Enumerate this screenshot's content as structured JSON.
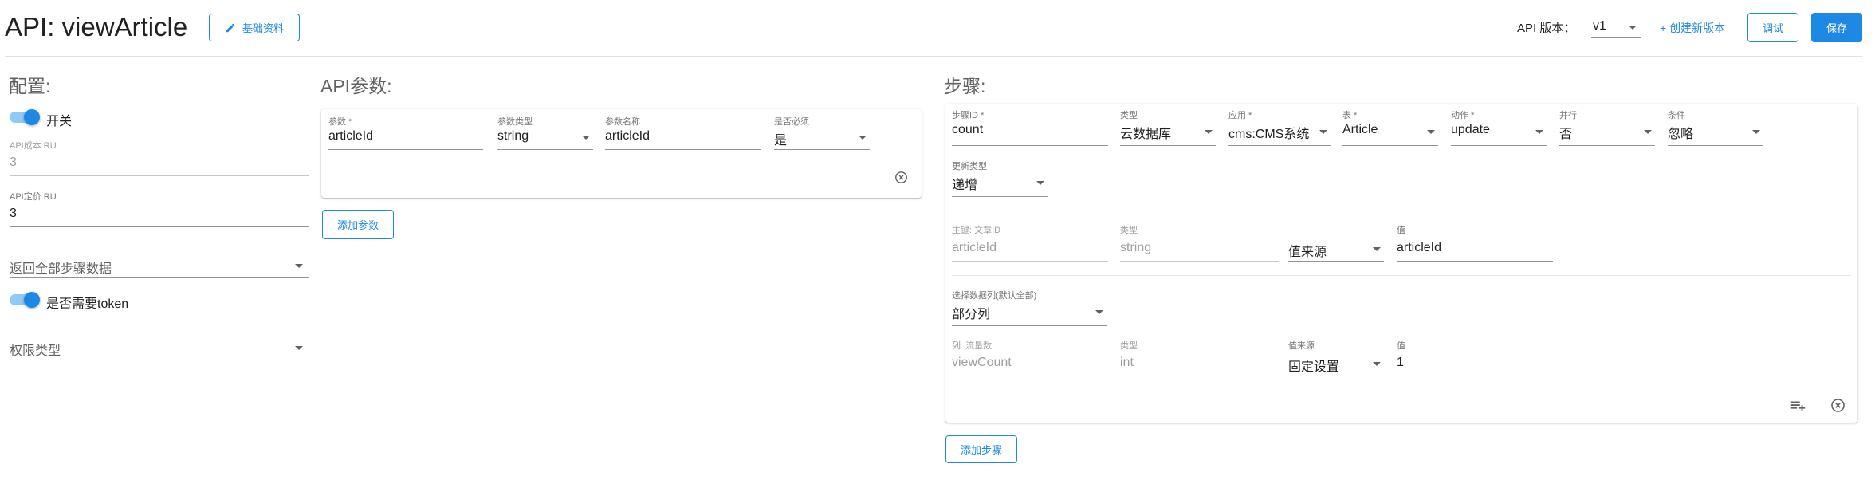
{
  "header": {
    "title": "API: viewArticle",
    "basic_info_label": "基础资料",
    "version_label": "API 版本：",
    "version_value": "v1",
    "create_version_label": "+ 创建新版本",
    "debug_label": "调试",
    "save_label": "保存"
  },
  "config": {
    "title": "配置:",
    "switch_label": "开关",
    "cost_label": "API成本:RU",
    "cost_value": "3",
    "price_label": "API定价:RU",
    "price_value": "3",
    "return_steps_placeholder": "返回全部步骤数据",
    "token_label": "是否需要token",
    "permission_placeholder": "权限类型"
  },
  "params": {
    "title": "API参数:",
    "headers": {
      "param": "参数 *",
      "type": "参数类型",
      "name": "参数名称",
      "required": "是否必须"
    },
    "row": {
      "param": "articleId",
      "type": "string",
      "name": "articleId",
      "required": "是"
    },
    "add_label": "添加参数"
  },
  "steps": {
    "title": "步骤:",
    "headers": {
      "step_id": "步骤ID *",
      "type": "类型",
      "app": "应用 *",
      "table": "表 *",
      "action": "动作 *",
      "parallel": "并行",
      "condition": "条件"
    },
    "values": {
      "step_id": "count",
      "type": "云数据库",
      "app": "cms:CMS系统",
      "table": "Article",
      "action": "update",
      "parallel": "否",
      "condition": "忽略"
    },
    "update_type_label": "更新类型",
    "update_type_value": "递增",
    "key_row": {
      "key_label": "主键: 文章ID",
      "key_value": "articleId",
      "type_label": "类型",
      "type_value": "string",
      "source_value": "值来源",
      "value_label": "值",
      "value": "articleId"
    },
    "columns_label": "选择数据列(默认全部)",
    "columns_value": "部分列",
    "col_row": {
      "col_label": "列: 流量数",
      "col_value": "viewCount",
      "type_label": "类型",
      "type_value": "int",
      "source_label": "值来源",
      "source_value": "固定设置",
      "value_label": "值",
      "value": "1"
    },
    "add_label": "添加步骤"
  },
  "colors": {
    "accent": "#1e88e5",
    "toggle_track": "#90caf9"
  },
  "icons": [
    "pencil-icon",
    "chevron-down-icon",
    "close-circle-icon",
    "playlist-add-icon"
  ]
}
